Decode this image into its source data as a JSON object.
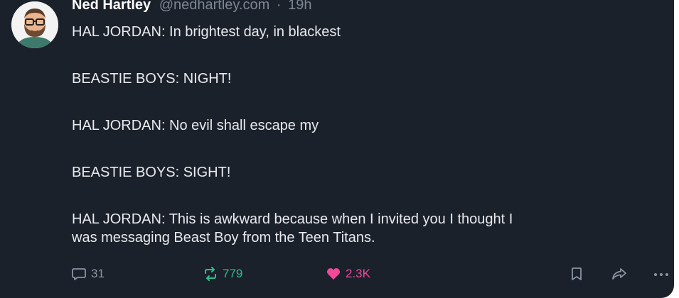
{
  "post": {
    "author": "Ned Hartley",
    "handle": "@nedhartley.com",
    "separator": "·",
    "time": "19h",
    "lines": [
      "HAL JORDAN: In brightest day, in blackest",
      "BEASTIE BOYS: NIGHT!",
      "HAL JORDAN: No evil shall escape my",
      "BEASTIE BOYS: SIGHT!",
      "HAL JORDAN: This is awkward because when I invited you I thought I",
      "was messaging Beast Boy from the Teen Titans."
    ]
  },
  "actions": {
    "replies": "31",
    "reposts": "779",
    "likes": "2.3K"
  },
  "icons": {
    "reply": "speech-bubble-icon",
    "repost": "repost-arrows-icon",
    "like": "heart-icon",
    "bookmark": "bookmark-icon",
    "share": "share-arrow-icon",
    "more": "more-dots-icon"
  },
  "colors": {
    "background": "#1b212b",
    "text": "#e8eaed",
    "muted": "#7c8794",
    "repost": "#2bc08a",
    "like": "#f1489a"
  }
}
